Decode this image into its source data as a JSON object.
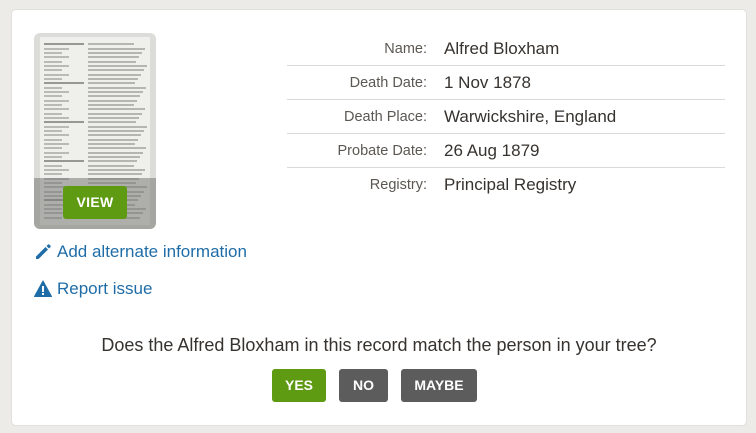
{
  "record": {
    "view_label": "VIEW",
    "fields": [
      {
        "label": "Name:",
        "value": "Alfred Bloxham"
      },
      {
        "label": "Death Date:",
        "value": "1 Nov 1878"
      },
      {
        "label": "Death Place:",
        "value": "Warwickshire, England"
      },
      {
        "label": "Probate Date:",
        "value": "26 Aug 1879"
      },
      {
        "label": "Registry:",
        "value": "Principal Registry"
      }
    ]
  },
  "links": {
    "add_alternate": "Add alternate information",
    "report_issue": "Report issue"
  },
  "match": {
    "question": "Does the Alfred Bloxham in this record match the person in your tree?",
    "yes_label": "YES",
    "no_label": "NO",
    "maybe_label": "MAYBE"
  },
  "colors": {
    "primary_green": "#5f9a13",
    "secondary_gray": "#5c5c5c",
    "link_blue": "#1f6da8"
  },
  "icons": {
    "add_alternate": "pencil-icon",
    "report_issue": "warning-icon"
  }
}
